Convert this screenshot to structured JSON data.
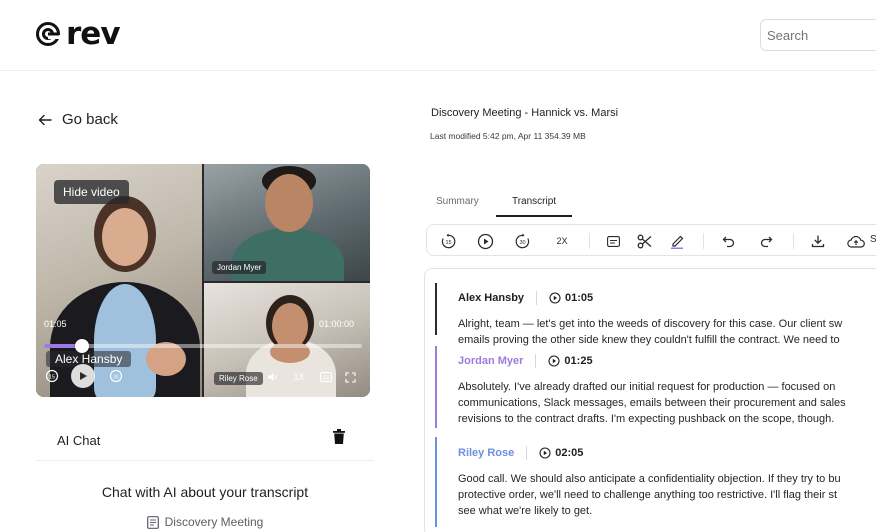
{
  "brand": {
    "name": "rev"
  },
  "header": {
    "search": {
      "placeholder": "Search"
    }
  },
  "nav": {
    "go_back": "Go back"
  },
  "video": {
    "hide_label": "Hide video",
    "participants": [
      "Alex Hansby",
      "Jordan Myer",
      "Riley Rose"
    ],
    "current_time": "01:05",
    "duration": "01:00:00",
    "progress": 0.12,
    "speed": "1X",
    "skip_back": "15",
    "skip_forward": "30"
  },
  "ai_chat": {
    "label": "AI Chat",
    "heading": "Chat with AI about your transcript",
    "document": "Discovery Meeting"
  },
  "document": {
    "title": "Discovery Meeting - Hannick vs. Marsi",
    "meta": "Last modified 5:42 pm, Apr 11 354.39 MB"
  },
  "tabs": [
    {
      "label": "Summary",
      "active": false
    },
    {
      "label": "Transcript",
      "active": true
    }
  ],
  "toolbar": {
    "rewind": "15",
    "forward": "30",
    "speed": "2X",
    "save_label": "Sa",
    "icons": [
      "rewind-15-icon",
      "play-icon",
      "forward-30-icon",
      "speed-2x-icon",
      "captions-icon",
      "scissors-icon",
      "highlighter-icon",
      "undo-icon",
      "redo-icon",
      "download-icon",
      "cloud-save-icon"
    ]
  },
  "transcript": {
    "segments": [
      {
        "speaker": "Alex Hansby",
        "time": "01:05",
        "color": "#2b2b30",
        "lines": [
          "Alright, team — let's get into the weeds of discovery for this case. Our client sw",
          "emails proving the other side knew they couldn't fulfill the contract. We need to"
        ]
      },
      {
        "speaker": "Jordan Myer",
        "time": "01:25",
        "color": "#9b7be0",
        "lines": [
          "Absolutely. I've already drafted our initial request for production — focused on",
          "communications, Slack messages, emails between their procurement and sales",
          "revisions to the contract drafts. I'm expecting pushback on the scope, though."
        ]
      },
      {
        "speaker": "Riley Rose",
        "time": "02:05",
        "color": "#6d8fe0",
        "lines": [
          "Good call. We should also anticipate a confidentiality objection. If they try to bu",
          "protective order, we'll need to challenge anything too restrictive. I'll flag their st",
          "see what we're likely to get."
        ]
      }
    ]
  }
}
